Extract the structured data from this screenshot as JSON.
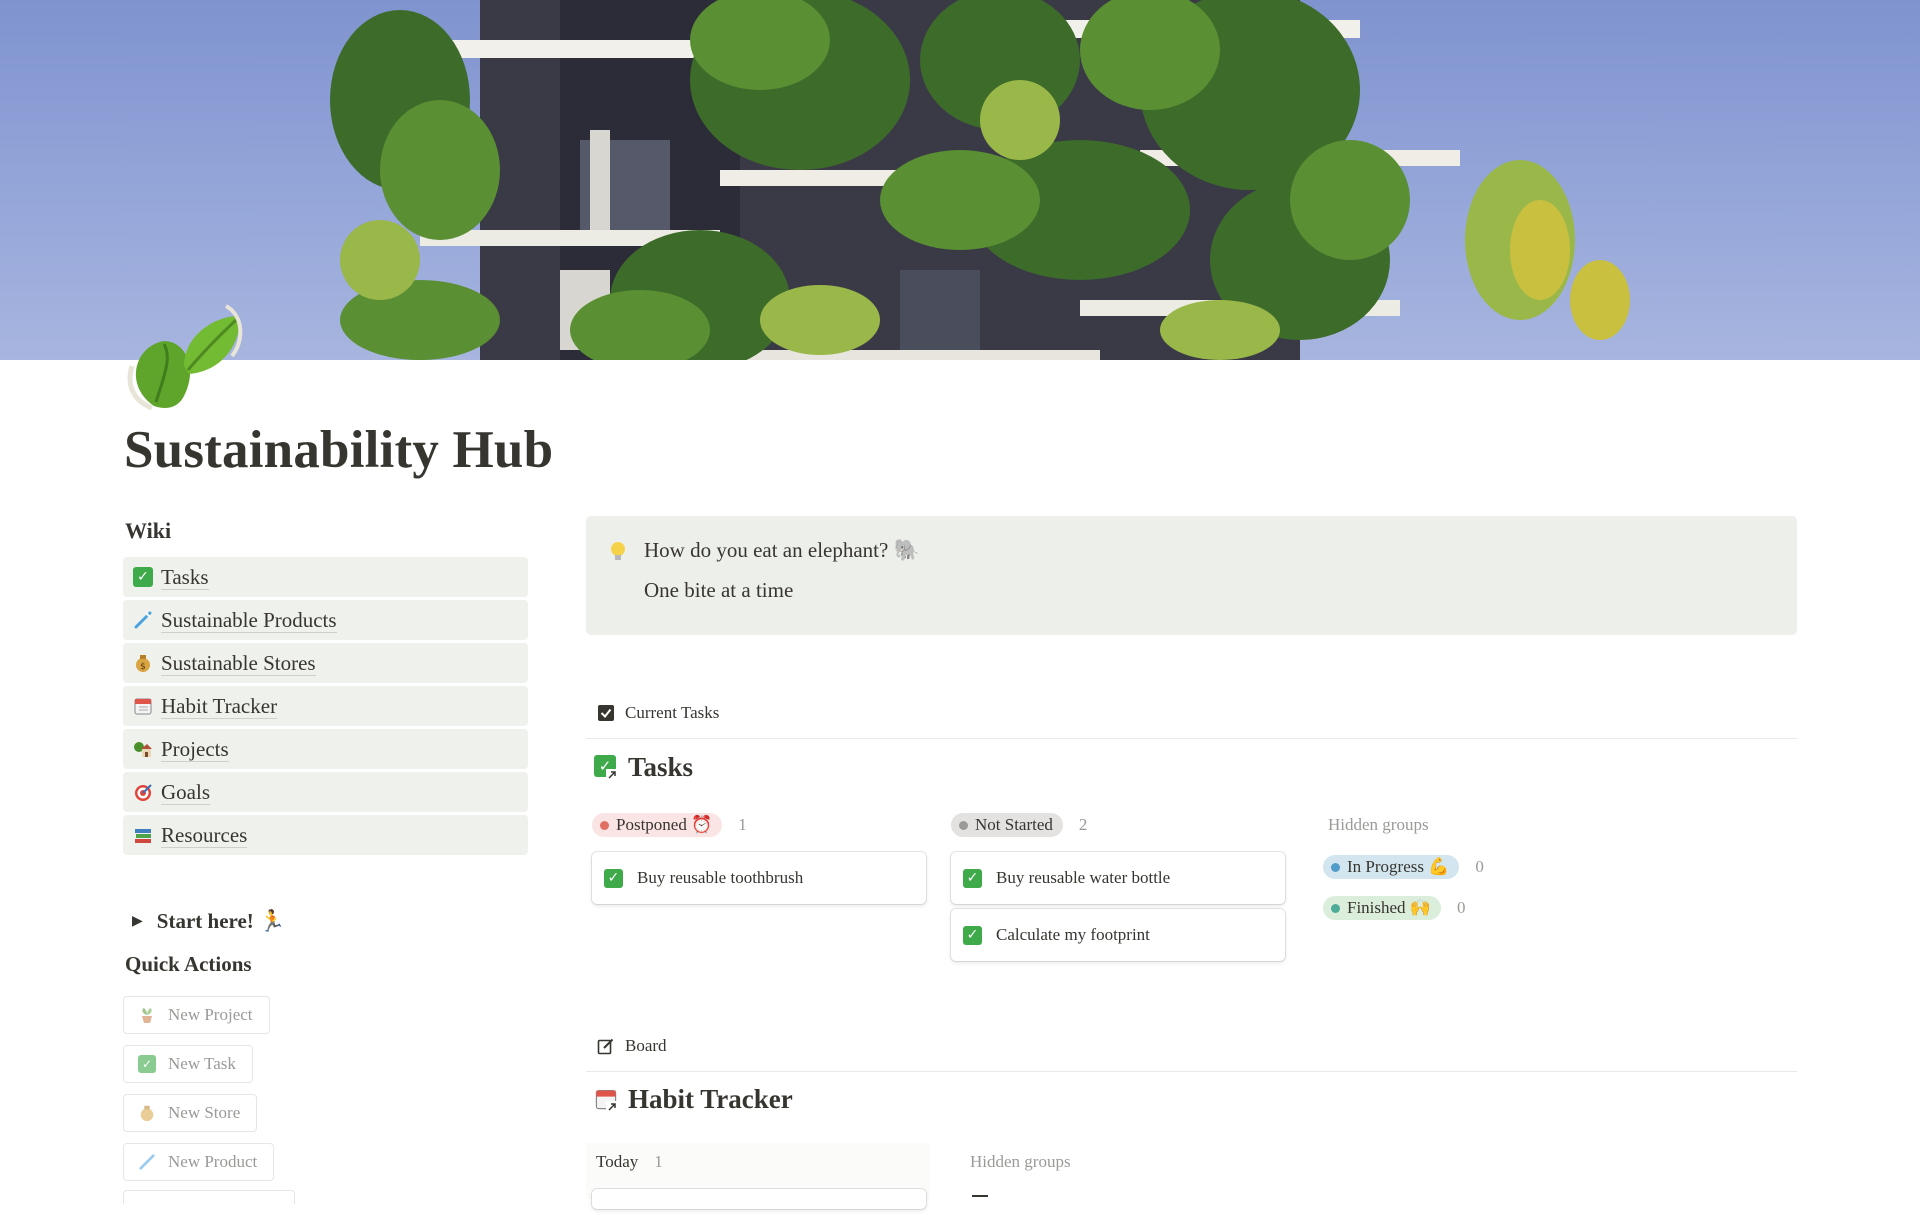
{
  "page": {
    "title": "Sustainability Hub"
  },
  "wiki": {
    "heading": "Wiki",
    "items": [
      {
        "label": "Tasks",
        "icon": "check-box-icon"
      },
      {
        "label": "Sustainable Products",
        "icon": "toothbrush-icon"
      },
      {
        "label": "Sustainable Stores",
        "icon": "money-bag-icon"
      },
      {
        "label": "Habit Tracker",
        "icon": "calendar-icon"
      },
      {
        "label": "Projects",
        "icon": "house-with-garden-icon"
      },
      {
        "label": "Goals",
        "icon": "target-icon"
      },
      {
        "label": "Resources",
        "icon": "books-icon"
      }
    ]
  },
  "start_toggle": {
    "label": "Start here! 🏃"
  },
  "quick_actions": {
    "heading": "Quick Actions",
    "buttons": [
      {
        "label": "New Project",
        "icon": "potted-plant-icon"
      },
      {
        "label": "New Task",
        "icon": "check-box-icon"
      },
      {
        "label": "New Store",
        "icon": "money-bag-icon"
      },
      {
        "label": "New Product",
        "icon": "toothbrush-icon"
      }
    ]
  },
  "callout": {
    "icon": "light-bulb-icon",
    "question": "How do you eat an elephant? 🐘",
    "answer": "One bite at a time"
  },
  "tasks_view": {
    "tab_label": "Current Tasks",
    "db_title": "Tasks",
    "groups": [
      {
        "label": "Postponed ⏰",
        "count": "1",
        "color": "#e16f64",
        "bg": "#fbe4e4",
        "cards": [
          "Buy reusable toothbrush"
        ]
      },
      {
        "label": "Not Started",
        "count": "2",
        "color": "#9b9a97",
        "bg": "#e3e2e0",
        "cards": [
          "Buy reusable water bottle",
          "Calculate my footprint"
        ]
      }
    ],
    "hidden_label": "Hidden groups",
    "hidden_groups": [
      {
        "label": "In Progress 💪",
        "count": "0",
        "color": "#529cca",
        "bg": "#d3e5ef"
      },
      {
        "label": "Finished 🙌",
        "count": "0",
        "color": "#4dab9a",
        "bg": "#dbeddb"
      }
    ]
  },
  "habit_view": {
    "tab_label": "Board",
    "db_title": "Habit Tracker",
    "today_label": "Today",
    "today_count": "1",
    "hidden_label": "Hidden groups"
  },
  "colors": {
    "wiki_item_bg": "#eef1ec",
    "callout_bg": "#edf0ea",
    "check_green": "#3eaa4a",
    "text": "#37352f",
    "muted": "#9b9a97"
  }
}
